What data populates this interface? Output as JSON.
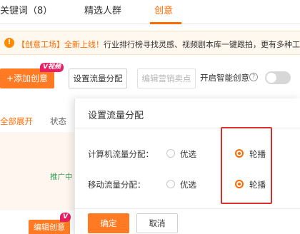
{
  "tabs": [
    {
      "label": "关键词（8）"
    },
    {
      "label": "精选人群"
    },
    {
      "label": "创意"
    }
  ],
  "notice": {
    "icon": "warning-icon",
    "tag": "【创意工场】全新上线！",
    "text": "行业排行榜寻找灵感、视频剧本库一键跟拍，更有多种工"
  },
  "toolbar": {
    "add_label": "+添加创意",
    "video_badge": "V视频",
    "set_traffic_label": "设置流量分配",
    "edit_selling_label": "编辑营销卖点",
    "smart_label": "开启智能创意",
    "help_glyph": "?"
  },
  "table": {
    "expand_label": "全部展开",
    "status_header": "状态",
    "promo_text": "推广中",
    "edit_creative_label": "编辑创意",
    "video_badge": "V"
  },
  "modal": {
    "title": "设置流量分配",
    "rows": [
      {
        "label": "计算机流量分配：",
        "opt1": "优选",
        "opt2": "轮播",
        "selected": "opt2"
      },
      {
        "label": "移动流量分配：",
        "opt1": "优选",
        "opt2": "轮播",
        "selected": "opt2"
      }
    ],
    "ok_label": "确定",
    "cancel_label": "取消"
  },
  "colors": {
    "accent": "#ff6a00",
    "highlight_border": "#d9302c",
    "badge": "#e91e63"
  }
}
